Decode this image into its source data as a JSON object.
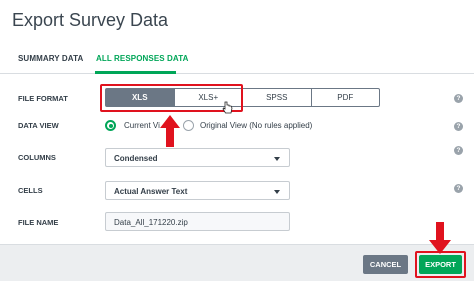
{
  "window": {
    "title": "Export Survey Data"
  },
  "tabs": [
    {
      "label": "SUMMARY DATA",
      "active": false
    },
    {
      "label": "ALL RESPONSES DATA",
      "active": true
    }
  ],
  "file_format": {
    "label": "FILE FORMAT",
    "options": [
      "XLS",
      "XLS+",
      "SPSS",
      "PDF"
    ],
    "selected": "XLS"
  },
  "data_view": {
    "label": "DATA VIEW",
    "options": [
      {
        "label": "Current Vi",
        "selected": true
      },
      {
        "label": "Original View (No rules applied)",
        "selected": false
      }
    ]
  },
  "columns": {
    "label": "COLUMNS",
    "value": "Condensed"
  },
  "cells": {
    "label": "CELLS",
    "value": "Actual Answer Text"
  },
  "file_name": {
    "label": "FILE NAME",
    "value": "Data_All_171220.zip"
  },
  "help": {
    "symbol": "?"
  },
  "footer": {
    "cancel_label": "CANCEL",
    "export_label": "EXPORT"
  },
  "colors": {
    "accent": "#00a658",
    "annotation": "#e0121e",
    "segment_selected": "#6b7785"
  },
  "icons": [
    "help-icon",
    "chevron-down-icon",
    "arrow-up-annotation",
    "arrow-down-annotation",
    "mouse-cursor-icon"
  ]
}
